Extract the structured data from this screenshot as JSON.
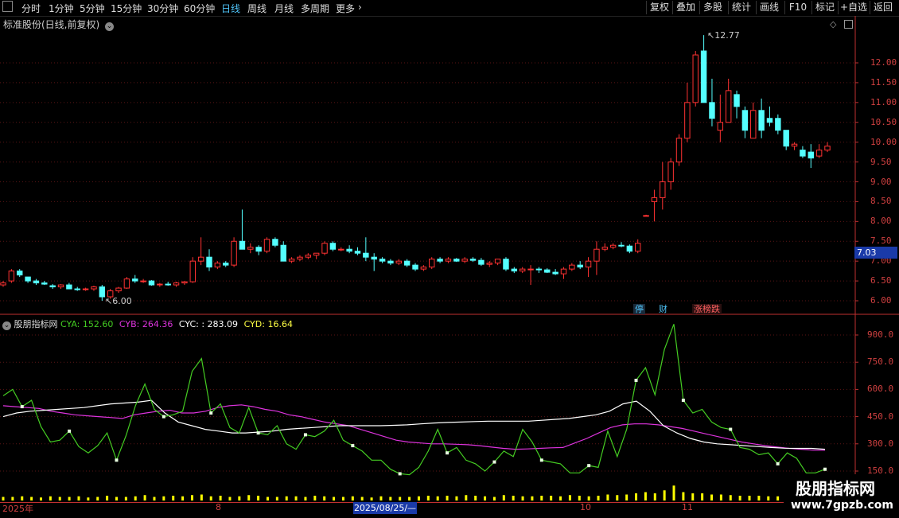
{
  "toolbar": {
    "periods": [
      "分时",
      "1分钟",
      "5分钟",
      "15分钟",
      "30分钟",
      "60分钟",
      "日线",
      "周线",
      "月线",
      "多周期",
      "更多"
    ],
    "active_period": "日线",
    "right_buttons": [
      "复权",
      "叠加",
      "多股",
      "统计",
      "画线",
      "F10",
      "标记",
      "+自选",
      "返回"
    ]
  },
  "chart_title": "标准股份(日线,前复权)",
  "price_axis": [
    "12.00",
    "11.50",
    "11.00",
    "10.50",
    "10.00",
    "9.50",
    "9.00",
    "8.50",
    "8.00",
    "7.50",
    "7.00",
    "6.50",
    "6.00"
  ],
  "current_price": "7.03",
  "high_marker": "12.77",
  "low_marker": "6.00",
  "badges": [
    {
      "text": "停",
      "color": "#4fc3f7"
    },
    {
      "text": "财",
      "color": "#4fc3f7"
    },
    {
      "text": "涨榜跌",
      "color": "#ff6060"
    }
  ],
  "indicator": {
    "name": "股朋指标网",
    "cya_label": "CYA:",
    "cya_value": "152.60",
    "cyb_label": "CYB:",
    "cyb_value": "264.36",
    "cyc_label": "CYC:",
    "cyc_value": ": 283.09",
    "cyd_label": "CYD:",
    "cyd_value": "16.64",
    "colors": {
      "cya": "#44cc22",
      "cyb": "#dd33dd",
      "cyc": "#ffffff",
      "cyd": "#ffff00"
    }
  },
  "indicator_axis": [
    "900.0",
    "750.0",
    "600.0",
    "450.0",
    "300.0",
    "150.0"
  ],
  "date_axis": {
    "labels": [
      {
        "text": "2025年"
      },
      {
        "text": "8"
      },
      {
        "text": "10"
      },
      {
        "text": "11"
      }
    ],
    "selected": "2025/08/25/—"
  },
  "watermark": {
    "title": "股朋指标网",
    "url": "www.7gpzb.com"
  },
  "chart_data": {
    "type": "candlestick",
    "ylim": [
      5.8,
      12.9
    ],
    "candles": [
      [
        6.4,
        6.5,
        6.35,
        6.45
      ],
      [
        6.5,
        6.8,
        6.45,
        6.75
      ],
      [
        6.75,
        6.8,
        6.6,
        6.65
      ],
      [
        6.6,
        6.6,
        6.45,
        6.5
      ],
      [
        6.5,
        6.55,
        6.4,
        6.45
      ],
      [
        6.45,
        6.5,
        6.4,
        6.42
      ],
      [
        6.38,
        6.42,
        6.3,
        6.35
      ],
      [
        6.35,
        6.42,
        6.3,
        6.4
      ],
      [
        6.4,
        6.45,
        6.3,
        6.3
      ],
      [
        6.3,
        6.35,
        6.25,
        6.28
      ],
      [
        6.28,
        6.33,
        6.25,
        6.3
      ],
      [
        6.3,
        6.38,
        6.25,
        6.35
      ],
      [
        6.35,
        6.4,
        6.0,
        6.1
      ],
      [
        6.1,
        6.3,
        6.05,
        6.25
      ],
      [
        6.25,
        6.35,
        6.2,
        6.32
      ],
      [
        6.32,
        6.6,
        6.3,
        6.55
      ],
      [
        6.55,
        6.65,
        6.45,
        6.5
      ],
      [
        6.5,
        6.55,
        6.45,
        6.5
      ],
      [
        6.5,
        6.52,
        6.38,
        6.4
      ],
      [
        6.4,
        6.45,
        6.35,
        6.42
      ],
      [
        6.42,
        6.48,
        6.38,
        6.4
      ],
      [
        6.4,
        6.48,
        6.35,
        6.45
      ],
      [
        6.45,
        6.5,
        6.4,
        6.48
      ],
      [
        6.48,
        7.1,
        6.45,
        7.0
      ],
      [
        7.0,
        7.6,
        6.9,
        7.1
      ],
      [
        7.1,
        7.3,
        6.75,
        6.85
      ],
      [
        6.85,
        7.0,
        6.8,
        6.95
      ],
      [
        6.95,
        7.0,
        6.85,
        6.9
      ],
      [
        6.9,
        7.6,
        6.85,
        7.5
      ],
      [
        7.5,
        8.3,
        7.3,
        7.3
      ],
      [
        7.3,
        7.45,
        7.2,
        7.35
      ],
      [
        7.35,
        7.4,
        7.15,
        7.25
      ],
      [
        7.25,
        7.6,
        7.2,
        7.55
      ],
      [
        7.55,
        7.6,
        7.35,
        7.4
      ],
      [
        7.4,
        7.5,
        7.0,
        7.0
      ],
      [
        7.0,
        7.1,
        6.95,
        7.05
      ],
      [
        7.05,
        7.15,
        7.0,
        7.1
      ],
      [
        7.1,
        7.2,
        7.05,
        7.15
      ],
      [
        7.15,
        7.2,
        7.05,
        7.2
      ],
      [
        7.2,
        7.5,
        7.15,
        7.45
      ],
      [
        7.45,
        7.5,
        7.25,
        7.3
      ],
      [
        7.3,
        7.35,
        7.25,
        7.3
      ],
      [
        7.3,
        7.4,
        7.2,
        7.25
      ],
      [
        7.25,
        7.35,
        7.15,
        7.2
      ],
      [
        7.2,
        7.6,
        7.0,
        7.1
      ],
      [
        7.1,
        7.2,
        6.75,
        7.05
      ],
      [
        7.05,
        7.1,
        6.95,
        7.0
      ],
      [
        7.0,
        7.05,
        6.9,
        6.95
      ],
      [
        6.95,
        7.05,
        6.9,
        7.0
      ],
      [
        7.0,
        7.05,
        6.85,
        6.9
      ],
      [
        6.9,
        6.95,
        6.75,
        6.8
      ],
      [
        6.8,
        6.9,
        6.75,
        6.85
      ],
      [
        6.85,
        7.1,
        6.8,
        7.05
      ],
      [
        7.05,
        7.1,
        6.95,
        7.0
      ],
      [
        7.0,
        7.1,
        6.95,
        7.05
      ],
      [
        7.05,
        7.08,
        6.98,
        7.0
      ],
      [
        7.0,
        7.1,
        6.95,
        7.05
      ],
      [
        7.05,
        7.1,
        6.98,
        7.02
      ],
      [
        7.02,
        7.08,
        6.88,
        6.92
      ],
      [
        6.92,
        7.0,
        6.85,
        6.95
      ],
      [
        6.95,
        7.05,
        6.9,
        7.05
      ],
      [
        7.05,
        7.1,
        6.75,
        6.8
      ],
      [
        6.8,
        6.85,
        6.7,
        6.75
      ],
      [
        6.75,
        6.85,
        6.7,
        6.8
      ],
      [
        6.8,
        6.9,
        6.4,
        6.8
      ],
      [
        6.8,
        6.85,
        6.7,
        6.78
      ],
      [
        6.78,
        6.82,
        6.7,
        6.72
      ],
      [
        6.72,
        6.8,
        6.65,
        6.68
      ],
      [
        6.68,
        6.85,
        6.55,
        6.8
      ],
      [
        6.8,
        6.95,
        6.75,
        6.9
      ],
      [
        6.9,
        7.0,
        6.8,
        6.85
      ],
      [
        6.85,
        7.1,
        6.6,
        7.0
      ],
      [
        7.0,
        7.5,
        6.65,
        7.3
      ],
      [
        7.3,
        7.45,
        7.25,
        7.35
      ],
      [
        7.35,
        7.45,
        7.3,
        7.4
      ],
      [
        7.4,
        7.48,
        7.35,
        7.38
      ],
      [
        7.38,
        7.42,
        7.2,
        7.25
      ],
      [
        7.25,
        7.55,
        7.2,
        7.45
      ],
      [
        8.15,
        8.17,
        8.13,
        8.15
      ],
      [
        8.5,
        8.8,
        8.0,
        8.6
      ],
      [
        8.6,
        9.5,
        8.3,
        9.0
      ],
      [
        9.0,
        9.6,
        8.8,
        9.5
      ],
      [
        9.5,
        10.2,
        9.4,
        10.1
      ],
      [
        10.1,
        11.5,
        10.0,
        11.0
      ],
      [
        11.0,
        12.3,
        10.9,
        12.2
      ],
      [
        12.3,
        12.7,
        11.0,
        11.0
      ],
      [
        11.0,
        11.6,
        10.4,
        10.6
      ],
      [
        10.3,
        11.2,
        10.0,
        10.5
      ],
      [
        10.5,
        11.6,
        10.5,
        11.3
      ],
      [
        11.2,
        11.3,
        10.6,
        10.9
      ],
      [
        10.8,
        10.9,
        10.1,
        10.3
      ],
      [
        10.1,
        11.0,
        10.1,
        10.8
      ],
      [
        10.8,
        11.1,
        10.1,
        10.3
      ],
      [
        10.6,
        10.9,
        10.4,
        10.5
      ],
      [
        10.6,
        10.7,
        10.2,
        10.3
      ],
      [
        10.3,
        10.3,
        9.8,
        9.9
      ],
      [
        9.9,
        10.0,
        9.8,
        9.95
      ],
      [
        9.8,
        9.9,
        9.6,
        9.65
      ],
      [
        9.75,
        9.95,
        9.35,
        9.6
      ],
      [
        9.65,
        9.95,
        9.6,
        9.8
      ],
      [
        9.8,
        10.0,
        9.75,
        9.9
      ]
    ],
    "indicator_ylim": [
      100,
      950
    ],
    "cya": [
      565,
      600,
      505,
      540,
      395,
      310,
      320,
      370,
      285,
      250,
      290,
      360,
      210,
      345,
      510,
      630,
      490,
      450,
      460,
      480,
      700,
      770,
      470,
      520,
      390,
      360,
      500,
      360,
      350,
      400,
      300,
      270,
      350,
      340,
      370,
      430,
      320,
      290,
      260,
      210,
      210,
      160,
      135,
      130,
      170,
      260,
      380,
      250,
      280,
      210,
      190,
      150,
      200,
      260,
      230,
      380,
      310,
      210,
      200,
      190,
      140,
      140,
      180,
      170,
      370,
      230,
      380,
      650,
      720,
      570,
      820,
      960,
      540,
      470,
      490,
      420,
      390,
      380,
      280,
      270,
      240,
      250,
      190,
      250,
      220,
      140,
      140,
      160
    ],
    "cyb": [
      510,
      505,
      500,
      495,
      480,
      470,
      460,
      455,
      450,
      445,
      440,
      460,
      470,
      480,
      485,
      470,
      470,
      480,
      500,
      510,
      515,
      505,
      490,
      480,
      460,
      450,
      435,
      420,
      410,
      400,
      380,
      360,
      340,
      320,
      310,
      305,
      300,
      300,
      298,
      295,
      290,
      282,
      275,
      270,
      272,
      275,
      278,
      280,
      305,
      330,
      360,
      390,
      405,
      410,
      410,
      405,
      395,
      385,
      370,
      355,
      340,
      325,
      310,
      300,
      290,
      282,
      275,
      270,
      265,
      265
    ],
    "cyc": [
      450,
      470,
      480,
      485,
      490,
      495,
      500,
      510,
      520,
      525,
      530,
      540,
      470,
      420,
      400,
      380,
      370,
      360,
      360,
      365,
      370,
      380,
      385,
      390,
      395,
      400,
      400,
      400,
      400,
      402,
      405,
      410,
      415,
      418,
      420,
      423,
      425,
      425,
      425,
      425,
      430,
      435,
      440,
      450,
      460,
      480,
      520,
      535,
      480,
      400,
      360,
      330,
      310,
      300,
      295,
      290,
      285,
      280,
      276,
      275,
      275,
      270
    ],
    "cyd": [
      6,
      6,
      7,
      6,
      5,
      7,
      6,
      6,
      7,
      5,
      6,
      8,
      6,
      6,
      7,
      9,
      6,
      7,
      8,
      7,
      9,
      10,
      7,
      8,
      6,
      7,
      9,
      8,
      6,
      6,
      7,
      7,
      6,
      8,
      7,
      6,
      6,
      7,
      6,
      5,
      7,
      6,
      6,
      6,
      7,
      8,
      7,
      8,
      7,
      9,
      8,
      7,
      6,
      9,
      8,
      7,
      7,
      8,
      8,
      7,
      9,
      8,
      7,
      8,
      10,
      9,
      10,
      12,
      14,
      12,
      17,
      25,
      14,
      12,
      12,
      10,
      10,
      9,
      8,
      8,
      8,
      7,
      7,
      9,
      7,
      6,
      7,
      8
    ]
  }
}
